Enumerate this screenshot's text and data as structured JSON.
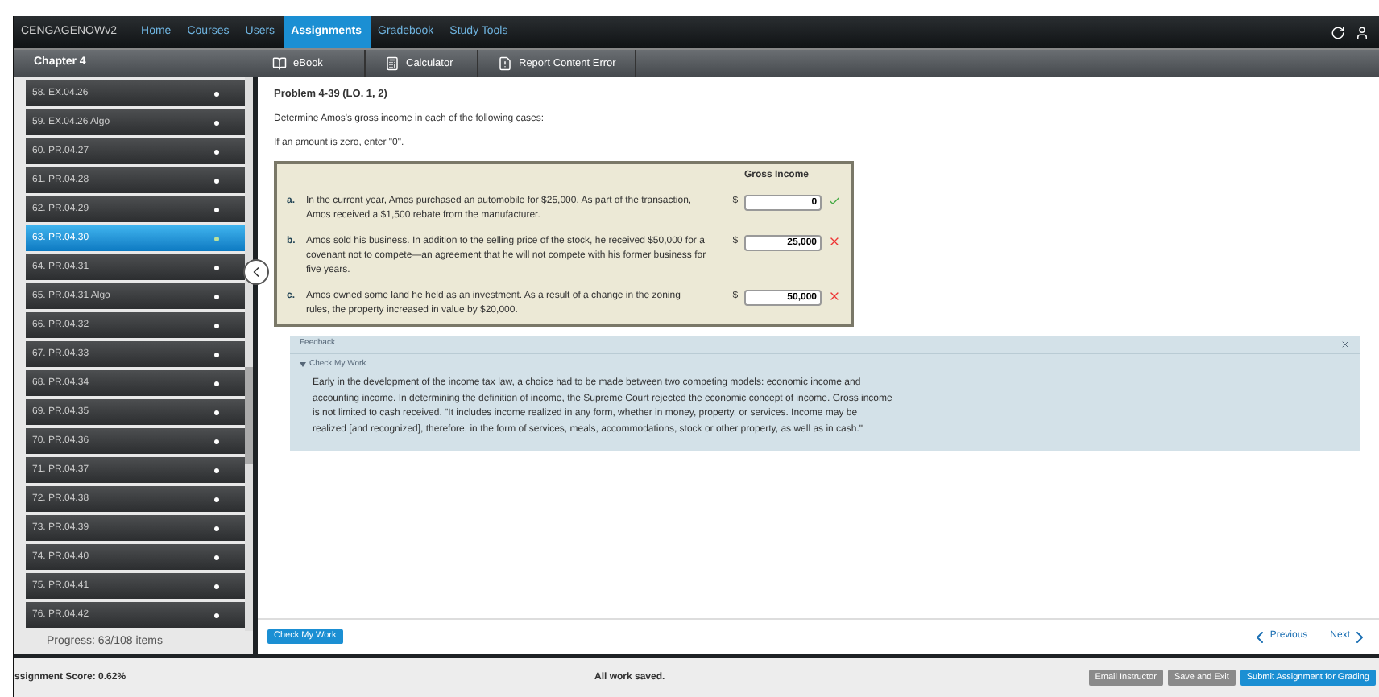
{
  "nav": {
    "logo": "CENGAGENOWv2",
    "items": [
      {
        "label": "Home",
        "selected": false
      },
      {
        "label": "Courses",
        "selected": false
      },
      {
        "label": "Users",
        "selected": false
      },
      {
        "label": "Assignments",
        "selected": true
      },
      {
        "label": "Gradebook",
        "selected": false
      },
      {
        "label": "Study Tools",
        "selected": false
      }
    ]
  },
  "sidebar": {
    "title": "Chapter 4",
    "items": [
      {
        "label": "58. EX.04.26",
        "selected": false
      },
      {
        "label": "59. EX.04.26 Algo",
        "selected": false
      },
      {
        "label": "60. PR.04.27",
        "selected": false
      },
      {
        "label": "61. PR.04.28",
        "selected": false
      },
      {
        "label": "62. PR.04.29",
        "selected": false
      },
      {
        "label": "63. PR.04.30",
        "selected": true
      },
      {
        "label": "64. PR.04.31",
        "selected": false
      },
      {
        "label": "65. PR.04.31 Algo",
        "selected": false
      },
      {
        "label": "66. PR.04.32",
        "selected": false
      },
      {
        "label": "67. PR.04.33",
        "selected": false
      },
      {
        "label": "68. PR.04.34",
        "selected": false
      },
      {
        "label": "69. PR.04.35",
        "selected": false
      },
      {
        "label": "70. PR.04.36",
        "selected": false
      },
      {
        "label": "71. PR.04.37",
        "selected": false
      },
      {
        "label": "72. PR.04.38",
        "selected": false
      },
      {
        "label": "73. PR.04.39",
        "selected": false
      },
      {
        "label": "74. PR.04.40",
        "selected": false
      },
      {
        "label": "75. PR.04.41",
        "selected": false
      },
      {
        "label": "76. PR.04.42",
        "selected": false
      }
    ],
    "progress": "Progress: 63/108 items"
  },
  "toolbar": [
    {
      "label": "eBook",
      "kind": "book"
    },
    {
      "label": "Calculator",
      "kind": "calculator"
    },
    {
      "label": "Report Content Error",
      "kind": "report"
    }
  ],
  "problem": {
    "title": "Problem 4-39 (LO. 1, 2)",
    "prompt": "Determine Amos's gross income in each of the following cases:",
    "note": "If an amount is zero, enter \"0\".",
    "column": "Gross Income",
    "rows": [
      {
        "letter": "a.",
        "text": "In the current year, Amos purchased an automobile for $25,000. As part of the transaction, Amos received a $1,500 rebate from the manufacturer.",
        "currency": "$",
        "value": "0",
        "correct": true
      },
      {
        "letter": "b.",
        "text": "Amos sold his business. In addition to the selling price of the stock, he received $50,000 for a covenant not to compete—an agreement that he will not compete with his former business for five years.",
        "currency": "$",
        "value": "25,000",
        "correct": false
      },
      {
        "letter": "c.",
        "text": "Amos owned some land he held as an investment. As a result of a change in the zoning rules, the property increased in value by $20,000.",
        "currency": "$",
        "value": "50,000",
        "correct": false
      }
    ]
  },
  "feedback": {
    "title": "Feedback",
    "toggle": "Check My Work",
    "expanded": true,
    "text": "Early in the development of the income tax law, a choice had to be made between two competing models: economic income and accounting income. In determining the definition of income, the Supreme Court rejected the economic concept of income. Gross income is not limited to cash received. \"It includes income realized in any form, whether in money, property, or services. Income may be realized [and recognized], therefore, in the form of services, meals, accommodations, stock or other property, as well as in cash.\""
  },
  "footer": {
    "check": "Check My Work",
    "previous": "Previous",
    "next": "Next"
  },
  "status_bar": {
    "score": "ssignment Score: 0.62%",
    "saved": "All work saved.",
    "buttons": [
      {
        "label": "Email Instructor",
        "kind": "secondary"
      },
      {
        "label": "Save and Exit",
        "kind": "secondary"
      },
      {
        "label": "Submit Assignment for Grading",
        "kind": "primary"
      }
    ]
  }
}
